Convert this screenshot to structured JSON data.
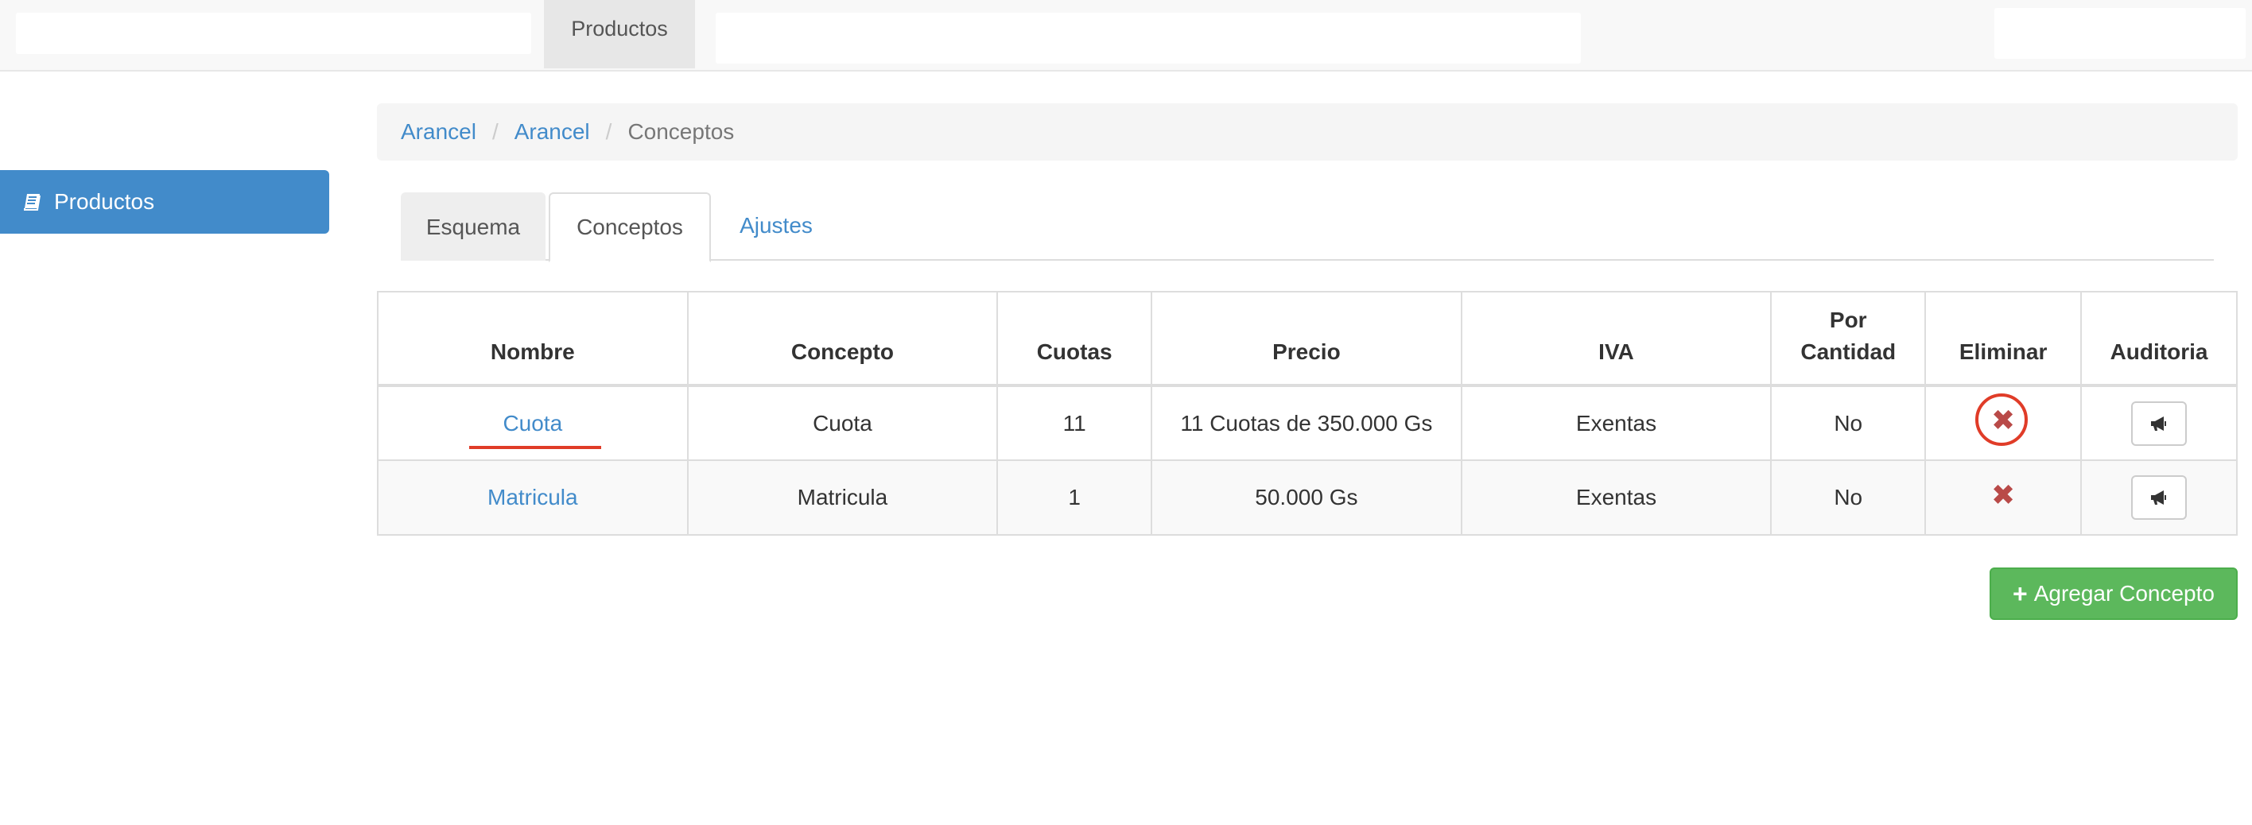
{
  "navbar": {
    "active_item": "Productos"
  },
  "sidebar": {
    "items": [
      {
        "label": "Productos",
        "icon": "book-icon"
      }
    ]
  },
  "breadcrumb": {
    "items": [
      "Arancel",
      "Arancel",
      "Conceptos"
    ]
  },
  "tabs": [
    {
      "label": "Esquema"
    },
    {
      "label": "Conceptos",
      "active": true
    },
    {
      "label": "Ajustes"
    }
  ],
  "table": {
    "headers": [
      "Nombre",
      "Concepto",
      "Cuotas",
      "Precio",
      "IVA",
      "Por Cantidad",
      "Eliminar",
      "Auditoria"
    ],
    "rows": [
      {
        "nombre": "Cuota",
        "concepto": "Cuota",
        "cuotas": "11",
        "precio": "11 Cuotas de 350.000 Gs",
        "iva": "Exentas",
        "por_cantidad": "No",
        "eliminar_icon": "✖"
      },
      {
        "nombre": "Matricula",
        "concepto": "Matricula",
        "cuotas": "1",
        "precio": "50.000 Gs",
        "iva": "Exentas",
        "por_cantidad": "No",
        "eliminar_icon": "✖"
      }
    ]
  },
  "actions": {
    "add_label": "Agregar Concepto",
    "add_icon": "+"
  },
  "colors": {
    "primary": "#428bca",
    "success": "#5cb85c",
    "danger": "#b94a48",
    "annotation": "#e03c28"
  }
}
